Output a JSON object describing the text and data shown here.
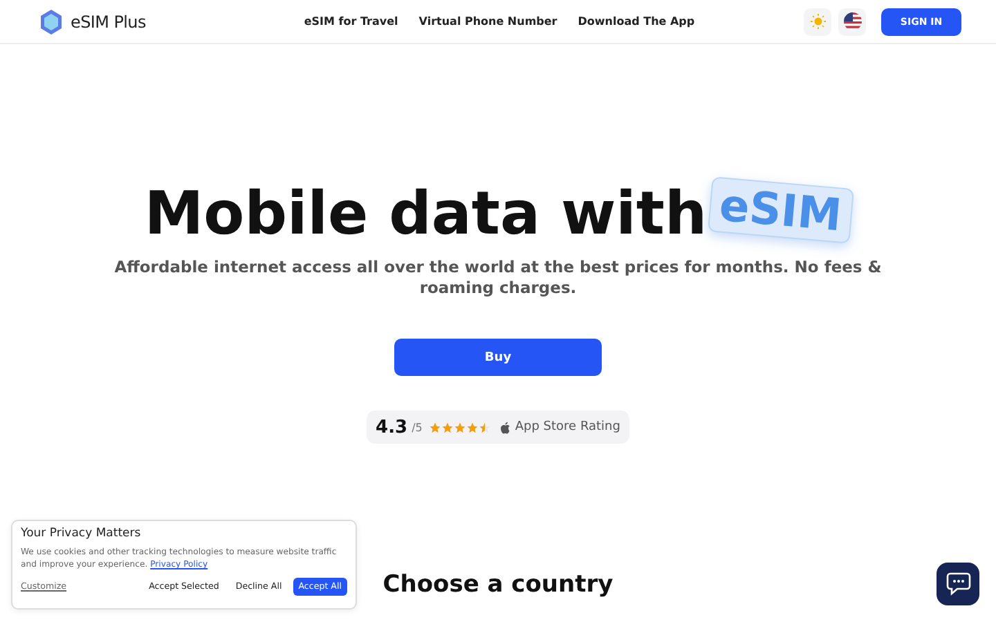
{
  "header": {
    "logo_text": "eSIM Plus",
    "nav": [
      "eSIM for Travel",
      "Virtual Phone Number",
      "Download The App"
    ],
    "sign_in": "SIGN IN"
  },
  "hero": {
    "title": "Mobile data with",
    "badge": "eSIM",
    "subtitle": "Affordable internet access all over the world at the best prices for months. No fees & roaming charges.",
    "button": "Buy"
  },
  "rating": {
    "score": "4.3",
    "scale": "/5",
    "stars": 4.5,
    "label": "App Store Rating"
  },
  "section_title": "Choose a country",
  "cookie_banner": {
    "title": "Your Privacy Matters",
    "text": "We use cookies and other tracking technologies to measure website traffic and improve your experience.",
    "link": "Privacy Policy",
    "customize": "Customize",
    "buttons": [
      {
        "label": "Accept Selected",
        "primary": false
      },
      {
        "label": "Decline All",
        "primary": false
      },
      {
        "label": "Accept All",
        "primary": true
      }
    ]
  }
}
